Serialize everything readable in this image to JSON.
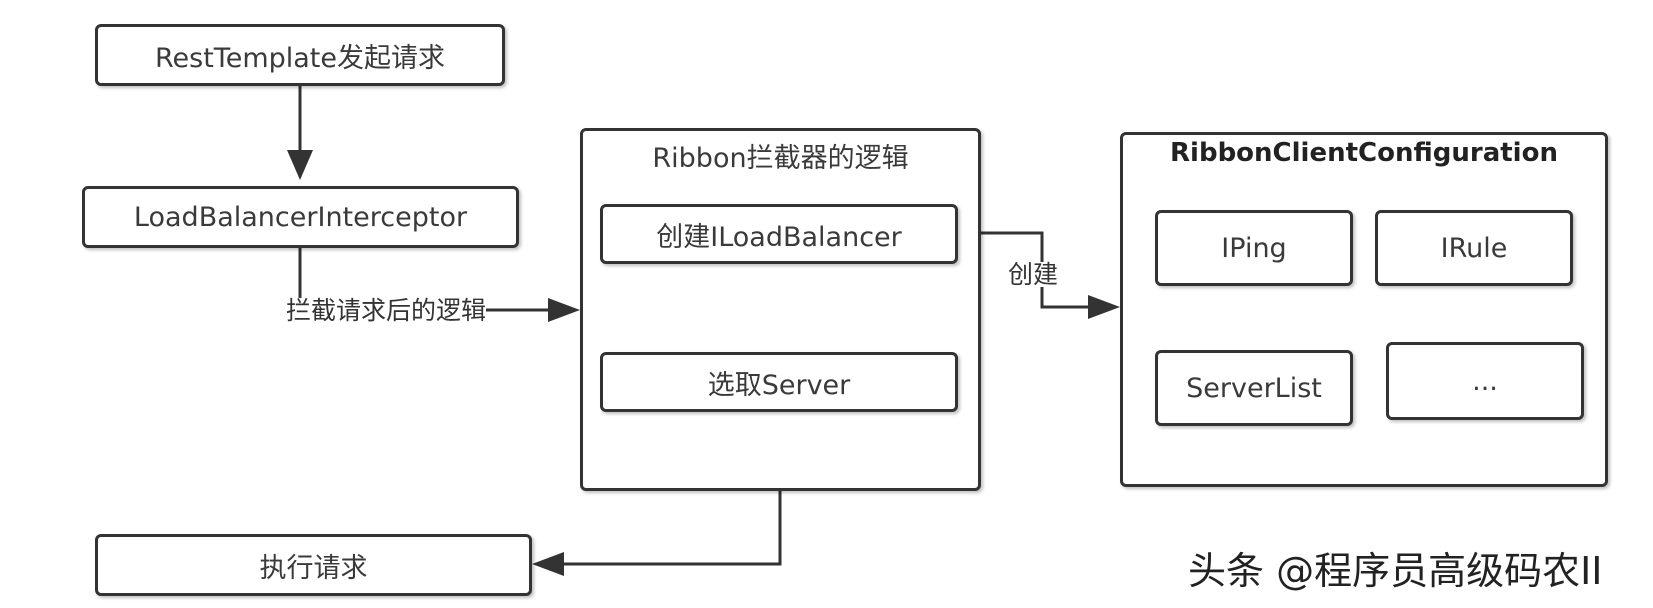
{
  "nodes": {
    "rest_template": "RestTemplate发起请求",
    "load_balancer_interceptor": "LoadBalancerInterceptor",
    "execute_request": "执行请求",
    "ribbon_logic": {
      "title": "Ribbon拦截器的逻辑",
      "create_lb": "创建ILoadBalancer",
      "select_server": "选取Server"
    },
    "ribbon_config": {
      "title": "RibbonClientConfiguration",
      "items": [
        "IPing",
        "IRule",
        "ServerList",
        "..."
      ]
    }
  },
  "edges": {
    "after_intercept_label": "拦截请求后的逻辑",
    "create_label": "创建"
  },
  "watermark": "头条 @程序员高级码农II",
  "colors": {
    "stroke": "#333333",
    "text": "#3a3a3a",
    "background": "#ffffff"
  }
}
